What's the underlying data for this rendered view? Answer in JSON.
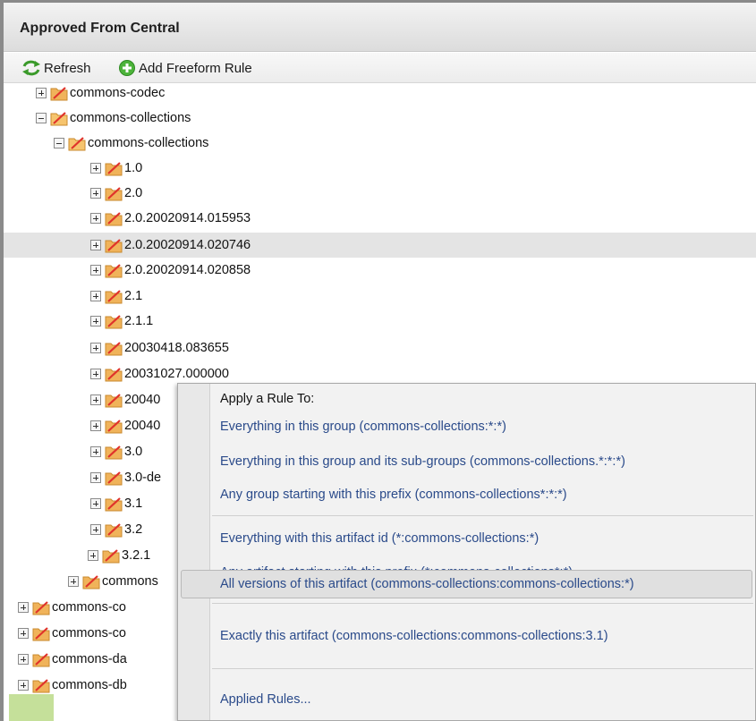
{
  "panel": {
    "title": "Approved From Central"
  },
  "toolbar": {
    "refresh_label": "Refresh",
    "add_rule_label": "Add Freeform Rule"
  },
  "tree": {
    "rows": [
      "commons-codec",
      "commons-collections",
      "commons-collections",
      "1.0",
      "2.0",
      "2.0.20020914.015953",
      "2.0.20020914.020746",
      "2.0.20020914.020858",
      "2.1",
      "2.1.1",
      "20030418.083655",
      "20031027.000000",
      "20040",
      "20040",
      "3.0",
      "3.0-de",
      "3.1",
      "3.2",
      "3.2.1",
      "commons",
      "commons-co",
      "commons-co",
      "commons-da",
      "commons-db"
    ]
  },
  "context_menu": {
    "heading": "Apply a Rule To:",
    "items": [
      "Everything in this group (commons-collections:*:*)",
      "Everything in this group and its sub-groups (commons-collections.*:*:*)",
      "Any group starting with this prefix (commons-collections*:*:*)",
      "Everything with this artifact id (*:commons-collections:*)",
      "Any artifact starting with this prefix (*:commons-collections*:*)",
      "All versions of this artifact (commons-collections:commons-collections:*)",
      "Exactly this artifact (commons-collections:commons-collections:3.1)",
      "Applied Rules..."
    ]
  },
  "colors": {
    "menu_link": "#2a4a8a",
    "selection": "#e4e4e4",
    "status_chip": "#c5e09a"
  }
}
